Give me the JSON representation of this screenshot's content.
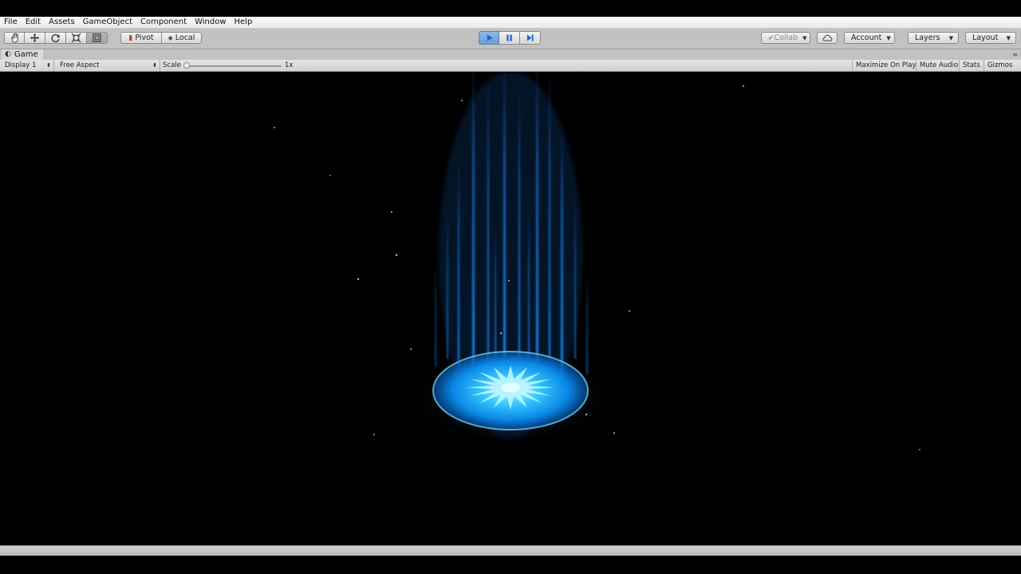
{
  "menubar": {
    "items": [
      "File",
      "Edit",
      "Assets",
      "GameObject",
      "Component",
      "Window",
      "Help"
    ]
  },
  "toolbar": {
    "tools": [
      {
        "name": "hand-tool",
        "icon": "hand-icon"
      },
      {
        "name": "move-tool",
        "icon": "move-arrows-icon"
      },
      {
        "name": "rotate-tool",
        "icon": "rotate-icon"
      },
      {
        "name": "scale-tool",
        "icon": "scale-icon"
      },
      {
        "name": "rect-tool",
        "icon": "rect-icon",
        "active": true
      }
    ],
    "pivot_label": "Pivot",
    "local_label": "Local",
    "playback": {
      "play_active": true
    },
    "collab_label": "Collab",
    "account_label": "Account",
    "layers_label": "Layers",
    "layout_label": "Layout"
  },
  "game_tab": {
    "title": "Game",
    "display": "Display 1",
    "aspect": "Free Aspect",
    "scale_label": "Scale",
    "scale_value_label": "1x",
    "scale_value": 1,
    "maximize_on_play": "Maximize On Play",
    "mute_audio": "Mute Audio",
    "stats": "Stats",
    "gizmos": "Gizmos"
  },
  "colors": {
    "effect_glow": "#39c6ff",
    "effect_core": "#7fe9ff",
    "beam": "#1a8fff",
    "play_active": "#6d9bd6"
  }
}
